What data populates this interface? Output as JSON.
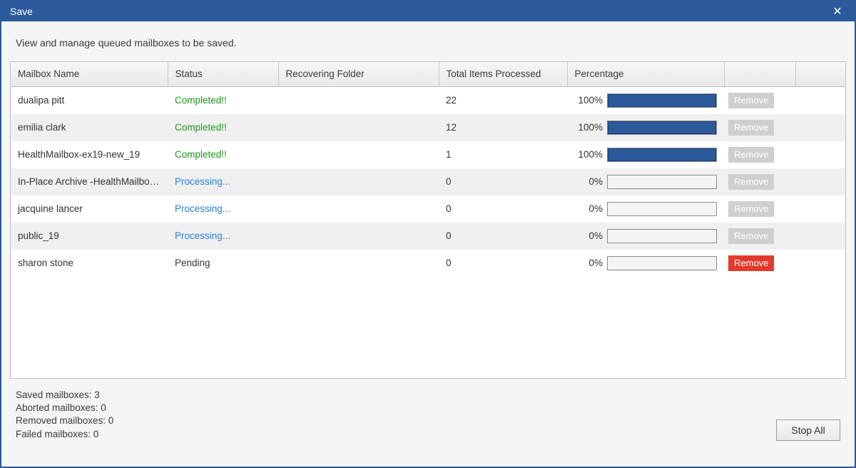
{
  "window": {
    "title": "Save",
    "close_glyph": "✕"
  },
  "intro": "View and manage queued mailboxes to be saved.",
  "columns": {
    "name": "Mailbox Name",
    "status": "Status",
    "folder": "Recovering Folder",
    "items": "Total Items Processed",
    "pct": "Percentage",
    "remove": "",
    "extra": ""
  },
  "rows": [
    {
      "name": "dualipa pitt",
      "status": "Completed!!",
      "status_class": "status-completed",
      "folder": "",
      "items": "22",
      "pct": "100%",
      "pct_value": 100,
      "remove_label": "Remove",
      "remove_enabled": false
    },
    {
      "name": "emilia clark",
      "status": "Completed!!",
      "status_class": "status-completed",
      "folder": "",
      "items": "12",
      "pct": "100%",
      "pct_value": 100,
      "remove_label": "Remove",
      "remove_enabled": false
    },
    {
      "name": "HealthMailbox-ex19-new_19",
      "status": "Completed!!",
      "status_class": "status-completed",
      "folder": "",
      "items": "1",
      "pct": "100%",
      "pct_value": 100,
      "remove_label": "Remove",
      "remove_enabled": false
    },
    {
      "name": "In-Place Archive -HealthMailbox...",
      "status": "Processing...",
      "status_class": "status-processing",
      "folder": "",
      "items": "0",
      "pct": "0%",
      "pct_value": 0,
      "remove_label": "Remove",
      "remove_enabled": false
    },
    {
      "name": "jacquine lancer",
      "status": "Processing...",
      "status_class": "status-processing",
      "folder": "",
      "items": "0",
      "pct": "0%",
      "pct_value": 0,
      "remove_label": "Remove",
      "remove_enabled": false
    },
    {
      "name": "public_19",
      "status": "Processing...",
      "status_class": "status-processing",
      "folder": "",
      "items": "0",
      "pct": "0%",
      "pct_value": 0,
      "remove_label": "Remove",
      "remove_enabled": false
    },
    {
      "name": "sharon stone",
      "status": "Pending",
      "status_class": "status-pending",
      "folder": "",
      "items": "0",
      "pct": "0%",
      "pct_value": 0,
      "remove_label": "Remove",
      "remove_enabled": true
    }
  ],
  "footer": {
    "saved": "Saved mailboxes: 3",
    "aborted": "Aborted mailboxes: 0",
    "removed": "Removed mailboxes: 0",
    "failed": "Failed mailboxes: 0",
    "stop_all": "Stop All"
  }
}
